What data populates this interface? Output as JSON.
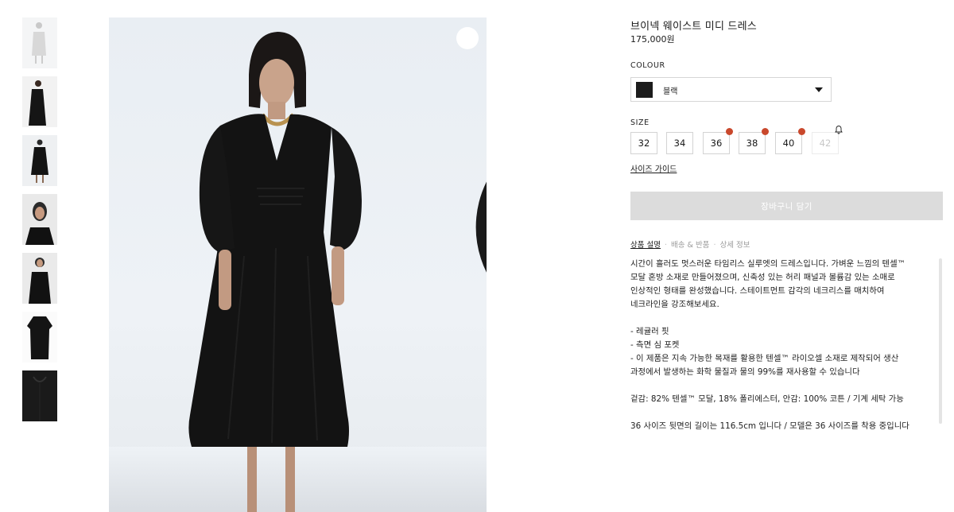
{
  "product": {
    "title": "브이넥 웨이스트 미디 드레스",
    "price": "175,000원"
  },
  "colour": {
    "label": "COLOUR",
    "selected": "블랙",
    "swatch_color": "#1c1c1c"
  },
  "size": {
    "label": "SIZE",
    "options": [
      {
        "label": "32",
        "low_stock": false,
        "available": true
      },
      {
        "label": "34",
        "low_stock": false,
        "available": true
      },
      {
        "label": "36",
        "low_stock": true,
        "available": true
      },
      {
        "label": "38",
        "low_stock": true,
        "available": true
      },
      {
        "label": "40",
        "low_stock": true,
        "available": true
      },
      {
        "label": "42",
        "low_stock": false,
        "available": false
      }
    ],
    "guide_link": "사이즈 가이드"
  },
  "cart_button": "장바구니 담기",
  "tabs": [
    {
      "label": "상품 설명",
      "active": true
    },
    {
      "label": "배송 & 반품",
      "active": false
    },
    {
      "label": "상세 정보",
      "active": false
    }
  ],
  "description": [
    "시간이 흘러도 멋스러운 타임리스 실루엣의 드레스입니다. 가벼운 느낌의 텐셀™",
    "모달 혼방 소재로 만들어졌으며, 신축성 있는 허리 패널과 볼륨감 있는 소매로",
    "인상적인 형태를 완성했습니다. 스테이트먼트 감각의 네크리스를 매치하여",
    "네크라인을 강조해보세요.",
    "",
    "- 레귤러 핏",
    "- 측면 심 포켓",
    "- 이 제품은 지속 가능한 목재를 활용한 텐셀™ 라이오셀 소재로 제작되어 생산",
    "과정에서 발생하는 화학 물질과 물의 99%를 재사용할 수 있습니다",
    "",
    "겉감: 82% 텐셀™ 모달, 18% 폴리에스터, 안감: 100% 코튼 / 기계 세탁 가능",
    "",
    "36 사이즈 뒷면의 길이는 116.5cm 입니다 / 모델은 36 사이즈를 착용 중입니다"
  ],
  "icons": {
    "wishlist": "heart-icon",
    "dropdown": "chevron-down-icon",
    "restock": "bell-icon"
  },
  "colors": {
    "low_stock_dot": "#c9482c",
    "cart_button_bg": "#dcdcdc"
  }
}
